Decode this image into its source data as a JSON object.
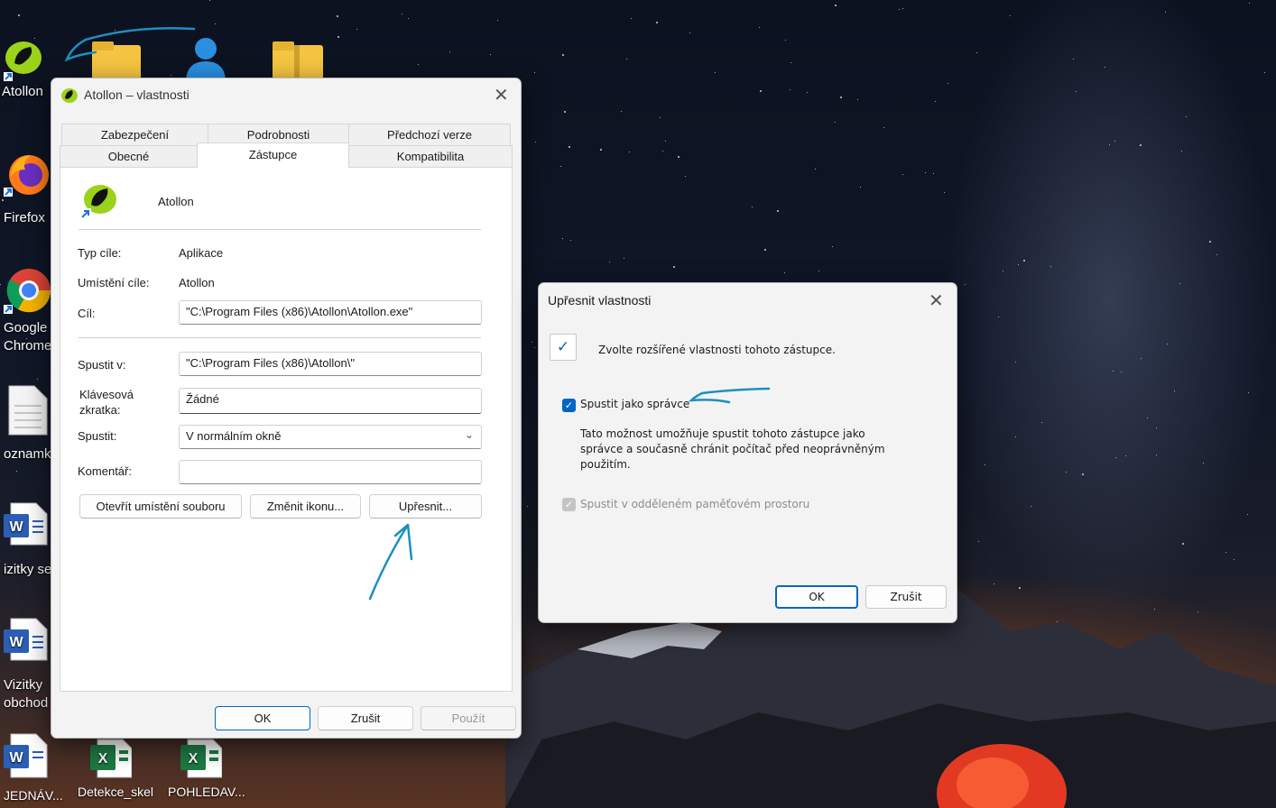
{
  "desktop_icons": [
    {
      "label": "Atollon",
      "icon": "atollon-icon"
    },
    {
      "label": "Firefox",
      "icon": "firefox-icon"
    },
    {
      "label": "Google Chrome",
      "icon": "chrome-icon"
    },
    {
      "label": "oznamk",
      "icon": "document-icon"
    },
    {
      "label": "izitky ser",
      "icon": "word-icon"
    },
    {
      "label": "Vizitky",
      "label2": "obchod (",
      "icon": "word-icon"
    },
    {
      "label": "JEDNÁV...",
      "icon": "word-icon"
    },
    {
      "label": "Detekce_skel",
      "icon": "excel-icon"
    },
    {
      "label": "POHLEDAV...",
      "icon": "excel-icon"
    }
  ],
  "properties_window": {
    "title": "Atollon – vlastnosti",
    "tabs_row1": [
      "Zabezpečení",
      "Podrobnosti",
      "Předchozí verze"
    ],
    "tabs_row2": [
      "Obecné",
      "Zástupce",
      "Kompatibilita"
    ],
    "active_tab": "Zástupce",
    "app_name": "Atollon",
    "fields": {
      "target_type_label": "Typ cíle:",
      "target_type_value": "Aplikace",
      "target_location_label": "Umístění cíle:",
      "target_location_value": "Atollon",
      "target_label": "Cíl:",
      "target_value": "\"C:\\Program Files (x86)\\Atollon\\Atollon.exe\"",
      "start_in_label": "Spustit v:",
      "start_in_value": "\"C:\\Program Files (x86)\\Atollon\\\"",
      "shortcut_key_label1": "Klávesová",
      "shortcut_key_label2": "zkratka:",
      "shortcut_key_value": "Žádné",
      "run_label": "Spustit:",
      "run_value": "V normálním okně",
      "comment_label": "Komentář:",
      "comment_value": ""
    },
    "buttons": {
      "open_location": "Otevřít umístění souboru",
      "change_icon": "Změnit ikonu...",
      "advanced": "Upřesnit...",
      "ok": "OK",
      "cancel": "Zrušit",
      "apply": "Použít"
    }
  },
  "advanced_dialog": {
    "title": "Upřesnit vlastnosti",
    "intro": "Zvolte rozšířené vlastnosti tohoto zástupce.",
    "run_as_admin_label": "Spustit jako správce",
    "run_as_admin_checked": true,
    "description_lines": [
      "Tato možnost umožňuje spustit tohoto zástupce jako",
      "správce a současně chránit počítač před neoprávněným",
      "použitím."
    ],
    "separate_memory_label": "Spustit v odděleném paměťovém prostoru",
    "separate_memory_checked": true,
    "separate_memory_enabled": false,
    "ok": "OK",
    "cancel": "Zrušit"
  },
  "colors": {
    "accent": "#0067c0",
    "annotation": "#1e8fbf"
  }
}
